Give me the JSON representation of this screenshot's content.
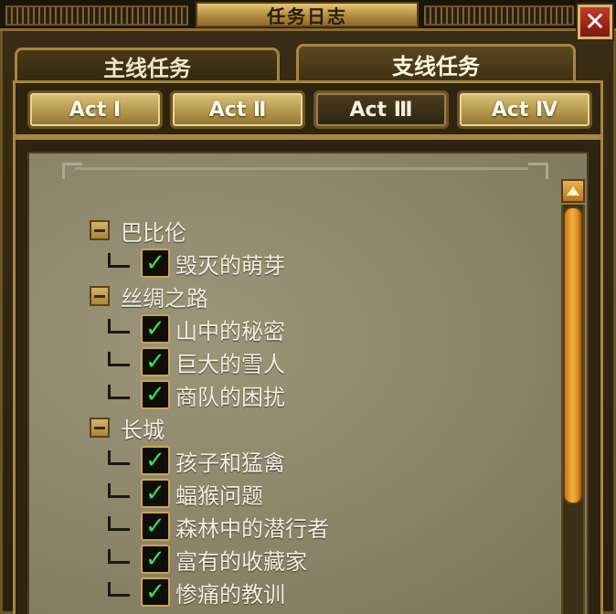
{
  "window": {
    "title": "任务日志",
    "close_label": "✕"
  },
  "main_tabs": [
    {
      "label": "主线任务",
      "active": false
    },
    {
      "label": "支线任务",
      "active": true
    }
  ],
  "act_tabs": [
    {
      "label": "Act Ⅰ",
      "selected": false
    },
    {
      "label": "Act Ⅱ",
      "selected": false
    },
    {
      "label": "Act Ⅲ",
      "selected": true
    },
    {
      "label": "Act Ⅳ",
      "selected": false
    }
  ],
  "quest_tree": [
    {
      "group": "巴比伦",
      "collapse_icon": "minus-icon",
      "quests": [
        {
          "name": "毁灭的萌芽",
          "completed": true
        }
      ]
    },
    {
      "group": "丝绸之路",
      "collapse_icon": "minus-icon",
      "quests": [
        {
          "name": "山中的秘密",
          "completed": true
        },
        {
          "name": "巨大的雪人",
          "completed": true
        },
        {
          "name": "商队的困扰",
          "completed": true
        }
      ]
    },
    {
      "group": "长城",
      "collapse_icon": "minus-icon",
      "quests": [
        {
          "name": "孩子和猛禽",
          "completed": true
        },
        {
          "name": "蝠猴问题",
          "completed": true
        },
        {
          "name": "森林中的潜行者",
          "completed": true
        },
        {
          "name": "富有的收藏家",
          "completed": true
        },
        {
          "name": "惨痛的教训",
          "completed": true
        }
      ]
    }
  ],
  "check_glyph": "✓",
  "colors": {
    "accent_gold": "#b28c3e",
    "panel_stone": "#8b8468",
    "check_green": "#38e05a",
    "close_red": "#c43a2a",
    "scrollbar_orange": "#f0b040"
  }
}
